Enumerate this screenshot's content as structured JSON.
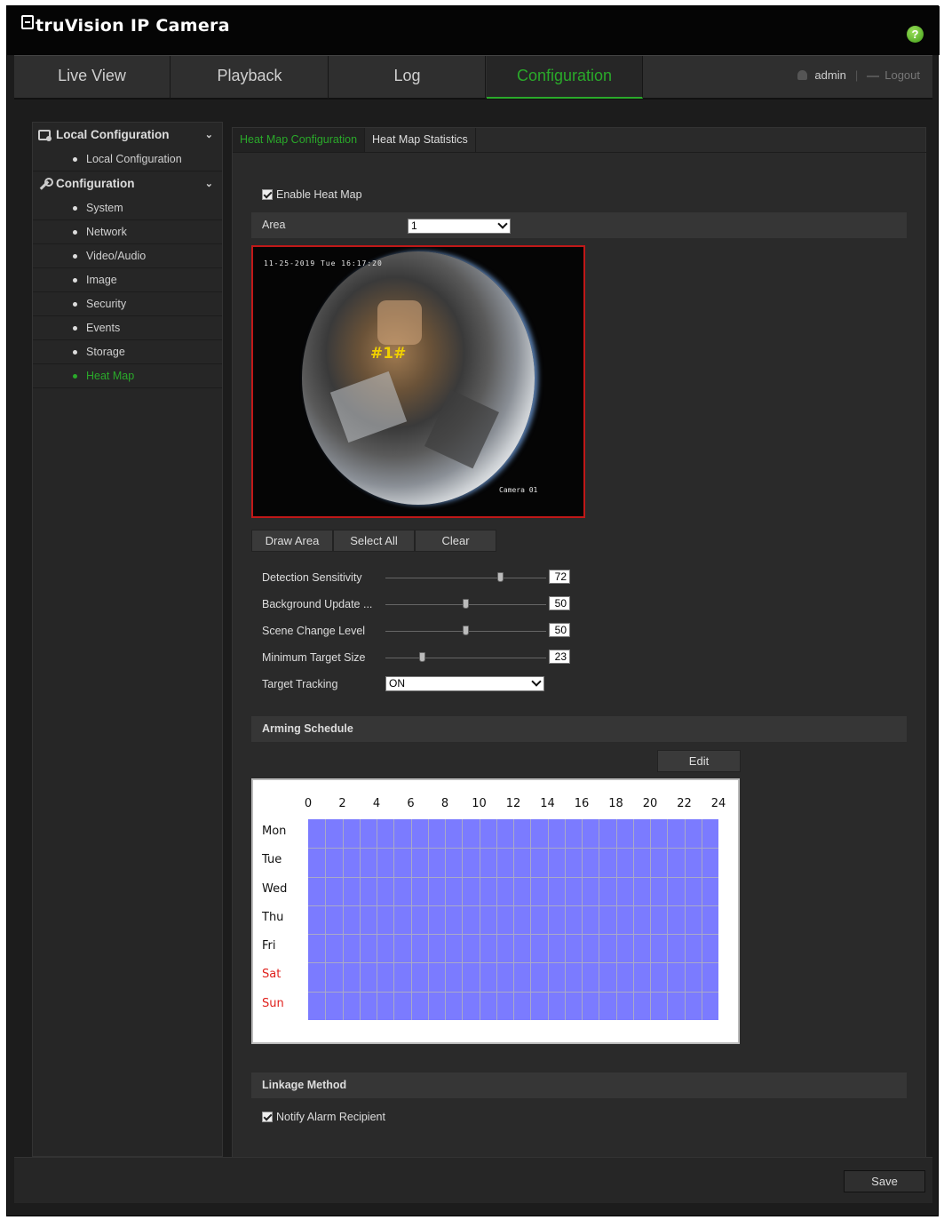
{
  "app": {
    "title": "truVision IP Camera",
    "help_glyph": "?",
    "icons": {
      "logo": "camera-logo-icon",
      "help": "help-icon"
    }
  },
  "nav": {
    "tabs": [
      {
        "label": "Live View"
      },
      {
        "label": "Playback"
      },
      {
        "label": "Log"
      },
      {
        "label": "Configuration",
        "active": true
      }
    ],
    "user": "admin",
    "logout": "Logout"
  },
  "sidebar": {
    "sections": [
      {
        "label": "Local Configuration",
        "icon": "local-config-icon",
        "items": [
          "Local Configuration"
        ]
      },
      {
        "label": "Configuration",
        "icon": "wrench-icon",
        "items": [
          "System",
          "Network",
          "Video/Audio",
          "Image",
          "Security",
          "Events",
          "Storage",
          "Heat Map"
        ]
      }
    ],
    "active_item": "Heat Map",
    "chevron": "⌄"
  },
  "panel": {
    "tabs": [
      {
        "label": "Heat Map Configuration",
        "active": true
      },
      {
        "label": "Heat Map Statistics"
      }
    ],
    "enable_label": "Enable Heat Map",
    "enable_checked": true,
    "area_label": "Area",
    "area_value": "1",
    "video": {
      "osd_time": "11-25-2019 Tue 16:17:20",
      "osd_name": "Camera 01",
      "area_marker": "#1#"
    },
    "draw_buttons": [
      "Draw Area",
      "Select All",
      "Clear"
    ],
    "sliders": [
      {
        "label": "Detection Sensitivity",
        "value": 72
      },
      {
        "label": "Background Update ...",
        "value": 50
      },
      {
        "label": "Scene Change Level",
        "value": 50
      },
      {
        "label": "Minimum Target Size",
        "value": 23
      }
    ],
    "target_tracking_label": "Target Tracking",
    "target_tracking_value": "ON",
    "arming_title": "Arming Schedule",
    "edit_label": "Edit",
    "schedule": {
      "hours": [
        "0",
        "2",
        "4",
        "6",
        "8",
        "10",
        "12",
        "14",
        "16",
        "18",
        "20",
        "22",
        "24"
      ],
      "days": [
        "Mon",
        "Tue",
        "Wed",
        "Thu",
        "Fri",
        "Sat",
        "Sun"
      ],
      "weekend_days": [
        "Sat",
        "Sun"
      ],
      "armed_all_day": true,
      "armed_color": "#7b7bff",
      "weekend_color": "#e0201c"
    },
    "linkage_title": "Linkage Method",
    "notify_label": "Notify Alarm Recipient",
    "notify_checked": true
  },
  "footer": {
    "save_label": "Save"
  },
  "colors": {
    "accent": "#2aa92a",
    "area_border": "#c01818",
    "background": "#1c1c1c"
  }
}
